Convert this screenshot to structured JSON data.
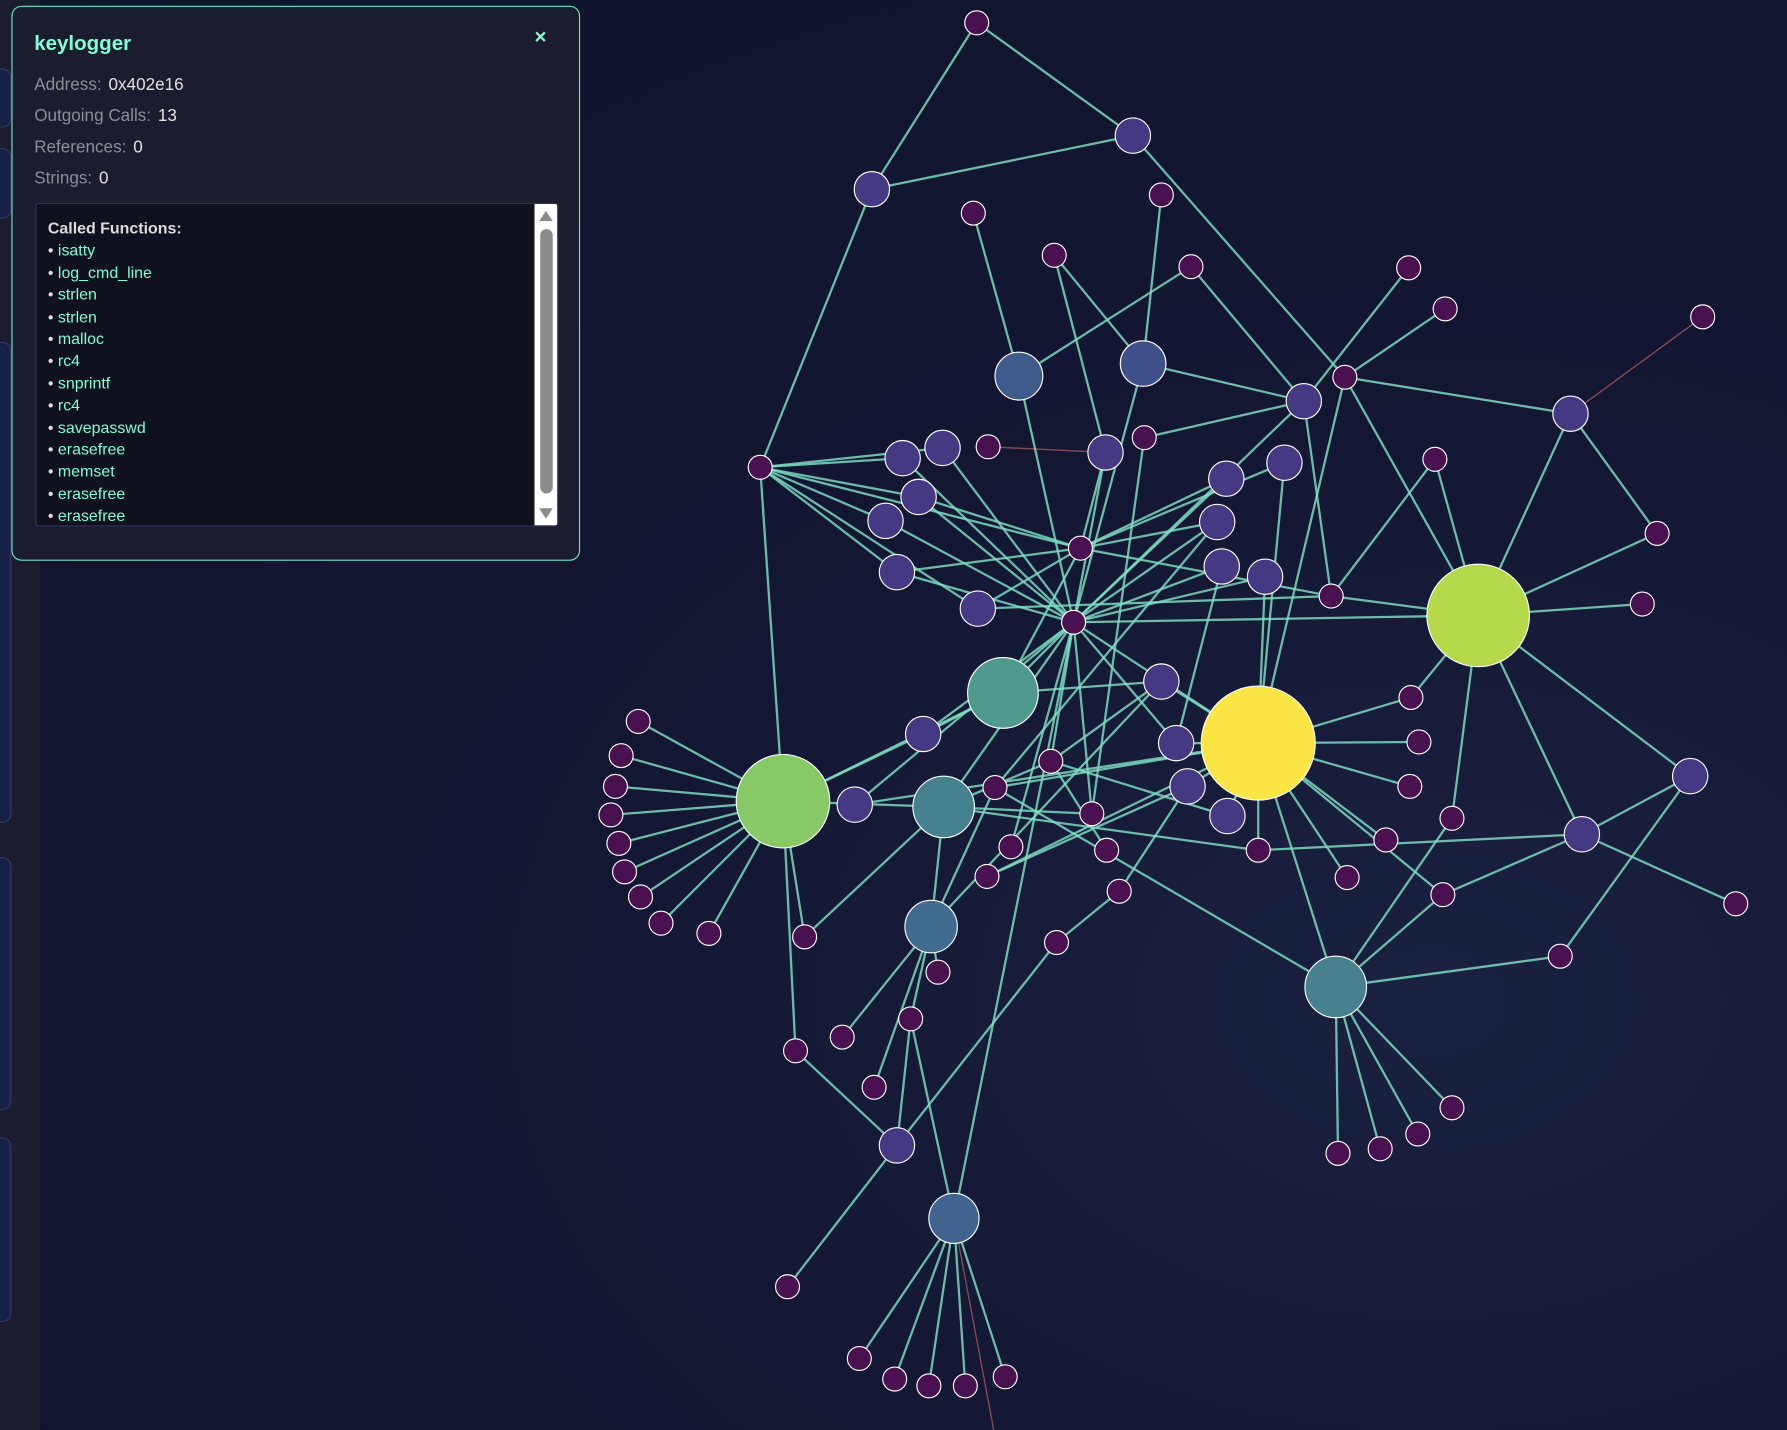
{
  "panel": {
    "title": "keylogger",
    "close_icon": "×",
    "address_label": "Address:",
    "address": "0x402e16",
    "outgoing_label": "Outgoing Calls:",
    "outgoing": "13",
    "references_label": "References:",
    "references": "0",
    "strings_label": "Strings:",
    "strings": "0",
    "called_header": "Called Functions:",
    "called_functions": [
      "isatty",
      "log_cmd_line",
      "strlen",
      "strlen",
      "malloc",
      "rc4",
      "snprintf",
      "rc4",
      "savepasswd",
      "erasefree",
      "memset",
      "erasefree",
      "erasefree"
    ]
  },
  "colors": {
    "accent": "#7fffd4",
    "edge": "#7fe0c4",
    "background": "#131733"
  }
}
